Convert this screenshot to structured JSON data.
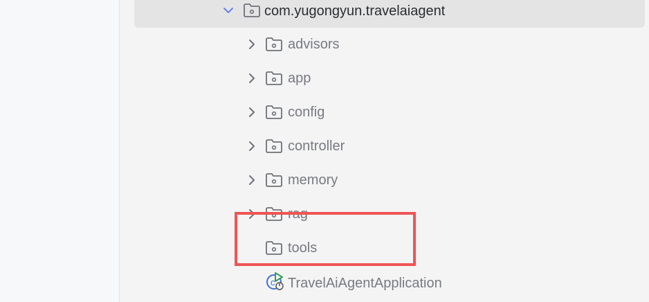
{
  "project_tree": {
    "package": {
      "label": "com.yugongyun.travelaiagent",
      "expanded": true
    },
    "folders": [
      {
        "label": "advisors"
      },
      {
        "label": "app"
      },
      {
        "label": "config"
      },
      {
        "label": "controller"
      },
      {
        "label": "memory"
      },
      {
        "label": "rag"
      },
      {
        "label": "tools"
      }
    ],
    "main_class": {
      "label": "TravelAiAgentApplication"
    }
  },
  "colors": {
    "highlight": "#f05454",
    "selection": "#e4e4e5",
    "accent": "#6a80e8"
  },
  "icons": {
    "expand": "chevron-down-icon",
    "collapse": "chevron-right-icon",
    "folder": "package-folder-icon",
    "app": "spring-boot-run-icon"
  }
}
